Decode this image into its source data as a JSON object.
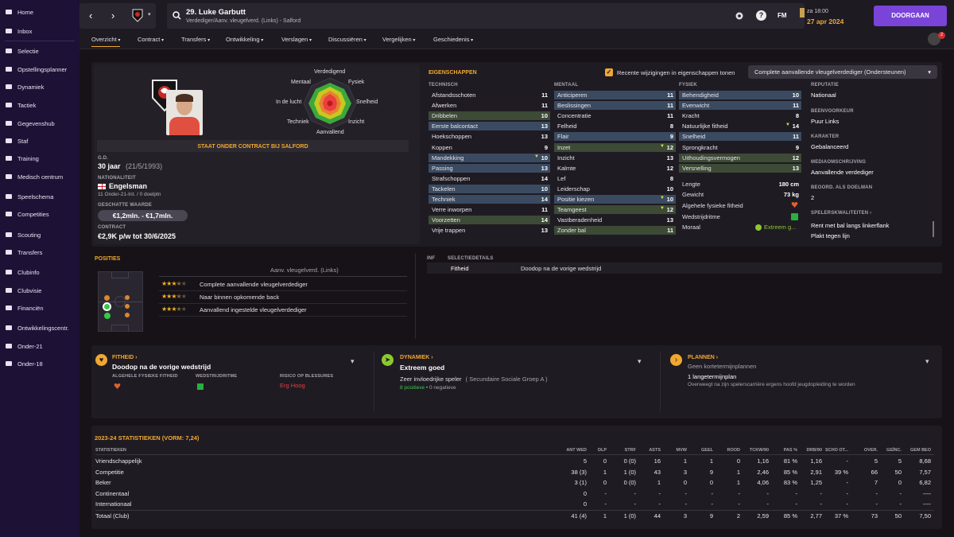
{
  "sidebar": {
    "items": [
      {
        "label": "Home",
        "icon": "home-icon"
      },
      {
        "label": "Inbox",
        "icon": "inbox-icon"
      },
      {
        "label": "Selectie",
        "icon": "squad-icon"
      },
      {
        "label": "Opstellingsplanner",
        "icon": "planner-icon"
      },
      {
        "label": "Dynamiek",
        "icon": "dynamics-icon"
      },
      {
        "label": "Tactiek",
        "icon": "tactics-icon"
      },
      {
        "label": "Gegevenshub",
        "icon": "data-hub-icon"
      },
      {
        "label": "Staf",
        "icon": "staff-icon"
      },
      {
        "label": "Training",
        "icon": "training-icon"
      },
      {
        "label": "Medisch centrum",
        "icon": "medical-icon"
      },
      {
        "label": "Speelschema",
        "icon": "schedule-icon"
      },
      {
        "label": "Competities",
        "icon": "trophy-icon"
      },
      {
        "label": "Scouting",
        "icon": "scouting-icon"
      },
      {
        "label": "Transfers",
        "icon": "transfers-icon"
      },
      {
        "label": "Clubinfo",
        "icon": "club-info-icon"
      },
      {
        "label": "Clubvisie",
        "icon": "club-vision-icon"
      },
      {
        "label": "Financiën",
        "icon": "finances-icon"
      },
      {
        "label": "Ontwikkelingscentr.",
        "icon": "development-icon"
      },
      {
        "label": "Onder-21",
        "icon": "u21-icon"
      },
      {
        "label": "Onder-18",
        "icon": "u18-icon"
      }
    ]
  },
  "header": {
    "player_name": "29. Luke Garbutt",
    "player_sub": "Verdediger/Aanv. vleugelverd. (Links) - Salford",
    "fm_label": "FM",
    "date_day": "za 18:00",
    "date": "27 apr 2024",
    "continue_label": "DOORGAAN",
    "notif_count": "2"
  },
  "menu": [
    "Overzicht",
    "Contract",
    "Transfers",
    "Ontwikkeling",
    "Verslagen",
    "Discussiëren",
    "Vergelijken",
    "Geschiedenis"
  ],
  "profile": {
    "contract_banner": "STAAT ONDER CONTRACT BIJ SALFORD",
    "age_label": "G.D.",
    "age": "30 jaar",
    "dob": "(21/5/1993)",
    "nat_label": "NATIONALITEIT",
    "nationality": "Engelsman",
    "caps": "11 Onder-21-Int. / 0 doelptn",
    "value_label": "GESCHATTE WAARDE",
    "value": "€1,2mln. - €1,7mln.",
    "contract_label": "CONTRACT",
    "contract": "€2,9K p/w tot 30/6/2025"
  },
  "radar": {
    "labels": [
      "Verdedigend",
      "Fysiek",
      "Snelheid",
      "Inzicht",
      "Aanvallend",
      "Techniek",
      "In de lucht",
      "Mentaal"
    ]
  },
  "attributes": {
    "title": "EIGENSCHAPPEN",
    "checkbox_label": "Recente wijzigingen in eigenschappen tonen",
    "role_select": "Complete aanvallende vleugelverdediger (Ondersteunen)",
    "technical_header": "TECHNISCH",
    "mental_header": "MENTAAL",
    "physical_header": "FYSIEK",
    "technical": [
      {
        "name": "Afstandsschoten",
        "value": "11",
        "hl": ""
      },
      {
        "name": "Afwerken",
        "value": "11",
        "hl": ""
      },
      {
        "name": "Dribbelen",
        "value": "10",
        "hl": "green"
      },
      {
        "name": "Eerste balcontact",
        "value": "13",
        "hl": "blue"
      },
      {
        "name": "Hoekschoppen",
        "value": "13",
        "hl": ""
      },
      {
        "name": "Koppen",
        "value": "9",
        "hl": ""
      },
      {
        "name": "Mandekking",
        "value": "10",
        "hl": "blue",
        "arrow": true
      },
      {
        "name": "Passing",
        "value": "13",
        "hl": "blue"
      },
      {
        "name": "Strafschoppen",
        "value": "14",
        "hl": ""
      },
      {
        "name": "Tackelen",
        "value": "10",
        "hl": "blue"
      },
      {
        "name": "Techniek",
        "value": "14",
        "hl": "blue"
      },
      {
        "name": "Verre inworpen",
        "value": "11",
        "hl": ""
      },
      {
        "name": "Voorzetten",
        "value": "14",
        "hl": "green"
      },
      {
        "name": "Vrije trappen",
        "value": "13",
        "hl": ""
      }
    ],
    "mental": [
      {
        "name": "Anticiperen",
        "value": "11",
        "hl": "blue"
      },
      {
        "name": "Beslissingen",
        "value": "11",
        "hl": "blue"
      },
      {
        "name": "Concentratie",
        "value": "11",
        "hl": ""
      },
      {
        "name": "Felheid",
        "value": "8",
        "hl": ""
      },
      {
        "name": "Flair",
        "value": "9",
        "hl": "blue"
      },
      {
        "name": "Inzet",
        "value": "12",
        "hl": "green",
        "arrow": true
      },
      {
        "name": "Inzicht",
        "value": "13",
        "hl": ""
      },
      {
        "name": "Kalmte",
        "value": "12",
        "hl": ""
      },
      {
        "name": "Lef",
        "value": "8",
        "hl": ""
      },
      {
        "name": "Leiderschap",
        "value": "10",
        "hl": ""
      },
      {
        "name": "Positie kiezen",
        "value": "10",
        "hl": "blue",
        "arrow": true
      },
      {
        "name": "Teamgeest",
        "value": "12",
        "hl": "green",
        "arrow": true
      },
      {
        "name": "Vastberadenheid",
        "value": "13",
        "hl": ""
      },
      {
        "name": "Zonder bal",
        "value": "11",
        "hl": "green"
      }
    ],
    "physical": [
      {
        "name": "Behendigheid",
        "value": "10",
        "hl": "blue"
      },
      {
        "name": "Evenwicht",
        "value": "11",
        "hl": "blue"
      },
      {
        "name": "Kracht",
        "value": "8",
        "hl": ""
      },
      {
        "name": "Natuurlijke fitheid",
        "value": "14",
        "hl": "",
        "arrow": true
      },
      {
        "name": "Snelheid",
        "value": "11",
        "hl": "blue"
      },
      {
        "name": "Sprongkracht",
        "value": "9",
        "hl": ""
      },
      {
        "name": "Uithoudingsvermogen",
        "value": "12",
        "hl": "green"
      },
      {
        "name": "Versnelling",
        "value": "13",
        "hl": "green"
      }
    ],
    "height_label": "Lengte",
    "height": "180 cm",
    "weight_label": "Gewicht",
    "weight": "73 kg",
    "fitness_label": "Algehele fysieke fitheid",
    "rhythm_label": "Wedstrijdritme",
    "morale_label": "Moraal",
    "morale": "Extreem g..."
  },
  "info": {
    "rep_label": "REPUTATIE",
    "rep": "Nationaal",
    "foot_label": "BEENVOORKEUR",
    "foot": "Puur Links",
    "char_label": "KARAKTER",
    "char": "Gebalanceerd",
    "media_label": "MEDIAOMSCHRIJVING",
    "media": "Aanvallende verdediger",
    "gk_label": "BEOORD. ALS DOELMAN",
    "gk": "2",
    "qual_label": "SPELERSKWALITEITEN",
    "quals": [
      "Rent met bal langs linkerflank",
      "Plakt tegen lijn"
    ]
  },
  "positions": {
    "title": "POSITIES",
    "subtitle": "Aanv. vleugelverd. (Links)",
    "roles": [
      {
        "stars": 3.5,
        "label": "Complete aanvallende vleugelverdediger"
      },
      {
        "stars": 3.5,
        "label": "Naar binnen opkomende back"
      },
      {
        "stars": 3.5,
        "label": "Aanvallend ingestelde vleugelverdediger"
      }
    ]
  },
  "selection": {
    "inf_label": "INF",
    "details_label": "SELECTIEDETAILS",
    "key": "Fitheid",
    "value": "Doodop na de vorige wedstrijd"
  },
  "cards": {
    "fitness": {
      "title": "FITHEID",
      "value": "Doodop na de vorige wedstrijd",
      "l1": "ALGEHELE FYSIEKE FITHEID",
      "l2": "WEDSTRIJDRITME",
      "l3": "RISICO OP BLESSURES",
      "risk": "Erg Hoog"
    },
    "dynamics": {
      "title": "DYNAMIEK",
      "value": "Extreem goed",
      "influence": "Zeer invloedrijke speler",
      "group": "( Secundaire Sociale Groep A )",
      "pos": "8 positieve",
      "sep": "•",
      "neg": "0 negatieve"
    },
    "plans": {
      "title": "PLANNEN",
      "sub": "Geen kortetermijnplannen",
      "long": "1 langetermijnplan",
      "note": "Overweegt na zijn spelerscarrière ergens hoofd jeugdopleiding te worden"
    }
  },
  "stats": {
    "title": "2023-24 STATISTIEKEN (VORM: 7,24)",
    "headers": [
      "STATISTIEKEN",
      "ANT WED",
      "DLP",
      "STRF",
      "ASTS",
      "MVW",
      "GEEL",
      "ROOD",
      "TCKW/90",
      "PAS %",
      "DRB/90",
      "SCHO OT...",
      "OVER.",
      "GEÏNC.",
      "GEM BEO"
    ],
    "rows": [
      [
        "Vriendschappelijk",
        "5",
        "0",
        "0 (0)",
        "16",
        "1",
        "1",
        "0",
        "1,16",
        "81 %",
        "1,16",
        "-",
        "5",
        "5",
        "8,68"
      ],
      [
        "Competitie",
        "38 (3)",
        "1",
        "1 (0)",
        "43",
        "3",
        "9",
        "1",
        "2,46",
        "85 %",
        "2,91",
        "39 %",
        "66",
        "50",
        "7,57"
      ],
      [
        "Beker",
        "3 (1)",
        "0",
        "0 (0)",
        "1",
        "0",
        "0",
        "1",
        "4,06",
        "83 %",
        "1,25",
        "-",
        "7",
        "0",
        "6,82"
      ],
      [
        "Continentaal",
        "0",
        "-",
        "-",
        "-",
        "-",
        "-",
        "-",
        "-",
        "-",
        "-",
        "-",
        "-",
        "-",
        "----"
      ],
      [
        "Internationaal",
        "0",
        "-",
        "-",
        "-",
        "-",
        "-",
        "-",
        "-",
        "-",
        "-",
        "-",
        "-",
        "-",
        "----"
      ],
      [
        "Totaal (Club)",
        "41 (4)",
        "1",
        "1 (0)",
        "44",
        "3",
        "9",
        "2",
        "2,59",
        "85 %",
        "2,77",
        "37 %",
        "73",
        "50",
        "7,50"
      ]
    ]
  }
}
